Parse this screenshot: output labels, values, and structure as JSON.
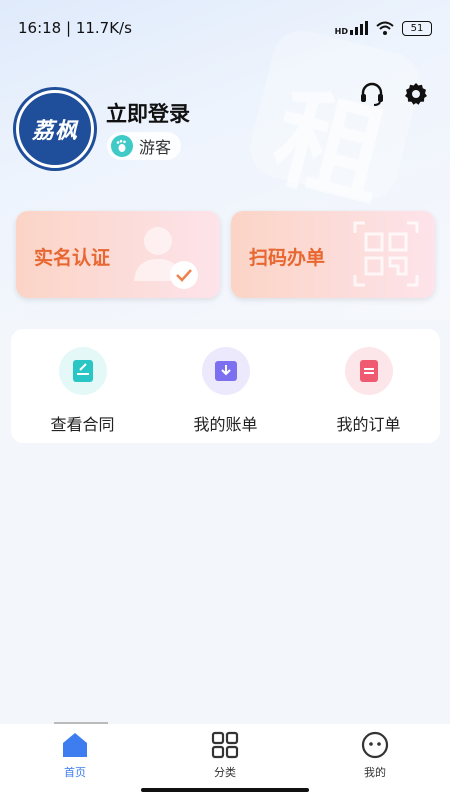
{
  "status_bar": {
    "time_speed": "16:18 | 11.7K/s",
    "battery": "51",
    "network_label": "HD"
  },
  "header": {
    "watermark_char": "租",
    "avatar_text": "荔枫",
    "login_title": "立即登录",
    "guest_label": "游客"
  },
  "cards": [
    {
      "label": "实名认证"
    },
    {
      "label": "扫码办单"
    }
  ],
  "menu": [
    {
      "label": "查看合同",
      "icon": "contract-icon",
      "color": "#2ac6c6"
    },
    {
      "label": "我的账单",
      "icon": "bill-icon",
      "color": "#7c6ff0"
    },
    {
      "label": "我的订单",
      "icon": "order-icon",
      "color": "#f05a70"
    }
  ],
  "tabs": [
    {
      "label": "首页",
      "icon": "home-icon",
      "active": true
    },
    {
      "label": "分类",
      "icon": "category-icon",
      "active": false
    },
    {
      "label": "我的",
      "icon": "profile-icon",
      "active": false
    }
  ],
  "colors": {
    "accent": "#3d7df0",
    "card_text": "#e8662f",
    "avatar_bg": "#1f4e9a"
  }
}
